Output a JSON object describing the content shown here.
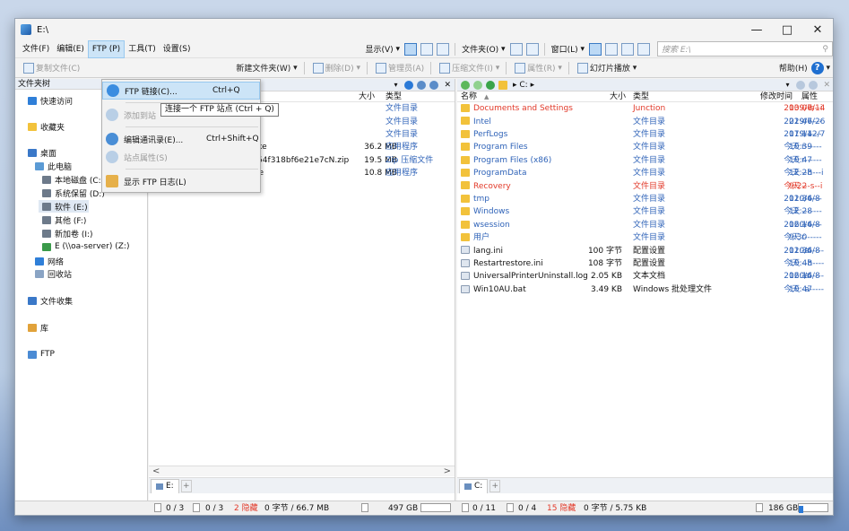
{
  "window": {
    "title": "E:\\"
  },
  "menu": {
    "items": [
      "文件(F)",
      "编辑(E)",
      "FTP (P)",
      "工具(T)",
      "设置(S)"
    ],
    "display_label": "显示(V)",
    "folder_label": "文件夹(O)",
    "window_label": "窗口(L)",
    "search_placeholder": "搜索 E:\\"
  },
  "toolbar": {
    "copy_file": "复制文件(C)",
    "new_folder": "新建文件夹(W)",
    "delete": "删除(D)",
    "admin": "管理员(A)",
    "compress": "压缩文件(I)",
    "properties": "属性(R)",
    "slideshow": "幻灯片播放",
    "help": "帮助(H)"
  },
  "ftp_menu": {
    "items": [
      {
        "label": "FTP 链接(C)...",
        "shortcut": "Ctrl+Q",
        "state": "highlighted"
      },
      {
        "label": "添加到站",
        "shortcut": "",
        "state": "disabled"
      },
      {
        "label": "编辑通讯录(E)...",
        "shortcut": "Ctrl+Shift+Q",
        "state": "normal"
      },
      {
        "label": "站点属性(S)",
        "shortcut": "",
        "state": "disabled"
      },
      {
        "label": "显示 FTP 日志(L)",
        "shortcut": "",
        "state": "normal"
      }
    ],
    "tooltip": "连接一个 FTP 站点 (Ctrl + Q)"
  },
  "tree": {
    "header": "文件夹树",
    "nodes": [
      {
        "label": "快速访问",
        "indent": 0
      },
      {
        "label": "收藏夹",
        "indent": 0
      },
      {
        "label": "桌面",
        "indent": 0
      },
      {
        "label": "此电脑",
        "indent": 1
      },
      {
        "label": "本地磁盘 (C:)",
        "indent": 2
      },
      {
        "label": "系统保留 (D:)",
        "indent": 2
      },
      {
        "label": "软件 (E:)",
        "indent": 2,
        "selected": true
      },
      {
        "label": "其他 (F:)",
        "indent": 2
      },
      {
        "label": "新加卷 (I:)",
        "indent": 2
      },
      {
        "label": "E (\\\\oa-server) (Z:)",
        "indent": 2
      },
      {
        "label": "网络",
        "indent": 1
      },
      {
        "label": "回收站",
        "indent": 1
      },
      {
        "label": "文件收集",
        "indent": 0
      },
      {
        "label": "库",
        "indent": 0
      },
      {
        "label": "FTP",
        "indent": 0
      }
    ]
  },
  "left_pane": {
    "columns": {
      "size": "大小",
      "type": "类型"
    },
    "rows": [
      {
        "name": "",
        "size": "",
        "type": "文件目录"
      },
      {
        "name": "",
        "size": "",
        "type": "文件目录"
      },
      {
        "name": "",
        "size": "",
        "type": "文件目录"
      },
      {
        "name": "DopusInstall-Chinese.exe",
        "size": "36.2 MB",
        "type": "应用程序"
      },
      {
        "name": "H1dea2e913ad24a22854f318bf6e21e7cN.zip",
        "size": "19.5 MB",
        "type": "Zip 压缩文件"
      },
      {
        "name": "TrayStatusSetup-4.6.exe",
        "size": "10.8 MB",
        "type": "应用程序"
      }
    ],
    "tab": "E:",
    "status": {
      "folders": "0 / 3",
      "files": "0 / 3",
      "hidden": "2 隐藏",
      "bytes": "0 字节 / 66.7 MB",
      "free": "497 GB",
      "used_fraction": 0.0
    }
  },
  "right_pane": {
    "path": "C:",
    "columns": {
      "name": "名称",
      "size": "大小",
      "type": "类型",
      "modified": "修改时间",
      "attr": "属性"
    },
    "rows": [
      {
        "name": "Documents and Settings",
        "size": "",
        "type": "Junction",
        "date": "2009/7/14",
        "time": "13:06",
        "attr": "---s--i",
        "red": true,
        "folder": true
      },
      {
        "name": "Intel",
        "size": "",
        "type": "文件目录",
        "date": "2019/7/26",
        "time": "22:46",
        "attr": "-------",
        "folder": true
      },
      {
        "name": "PerfLogs",
        "size": "",
        "type": "文件目录",
        "date": "2019/12/7",
        "time": "17:14",
        "attr": "-------",
        "folder": true
      },
      {
        "name": "Program Files",
        "size": "",
        "type": "文件目录",
        "date": "今天",
        "time": "10:39",
        "attr": "r------",
        "folder": true
      },
      {
        "name": "Program Files (x86)",
        "size": "",
        "type": "文件目录",
        "date": "今天",
        "time": "10:47",
        "attr": "r------",
        "folder": true
      },
      {
        "name": "ProgramData",
        "size": "",
        "type": "文件目录",
        "date": "今天",
        "time": "12:28",
        "attr": "--h---i",
        "folder": true
      },
      {
        "name": "Recovery",
        "size": "",
        "type": "文件目录",
        "date": "今天",
        "time": "9:22",
        "attr": "---s--i",
        "red": true,
        "folder": true
      },
      {
        "name": "tmp",
        "size": "",
        "type": "文件目录",
        "date": "2020/4/8",
        "time": "11:36",
        "attr": "-------",
        "folder": true
      },
      {
        "name": "Windows",
        "size": "",
        "type": "文件目录",
        "date": "今天",
        "time": "12:28",
        "attr": "-------",
        "folder": true
      },
      {
        "name": "wsession",
        "size": "",
        "type": "文件目录",
        "date": "2020/4/8",
        "time": "16:16",
        "attr": "-------",
        "folder": true
      },
      {
        "name": "用户",
        "size": "",
        "type": "文件目录",
        "date": "今天",
        "time": "9:30",
        "attr": "r------",
        "folder": true
      },
      {
        "name": "lang.ini",
        "size": "100 字节",
        "type": "配置设置",
        "date": "2020/4/8",
        "time": "11:36",
        "attr": "-a-----",
        "folder": false
      },
      {
        "name": "Restartrestore.ini",
        "size": "108 字节",
        "type": "配置设置",
        "date": "今天",
        "time": "10:48",
        "attr": "--h----",
        "folder": false
      },
      {
        "name": "UniversalPrinterUninstall.log",
        "size": "2.05 KB",
        "type": "文本文档",
        "date": "2020/4/8",
        "time": "16:16",
        "attr": "-a-----",
        "folder": false
      },
      {
        "name": "Win10AU.bat",
        "size": "3.49 KB",
        "type": "Windows 批处理文件",
        "date": "今天",
        "time": "10:47",
        "attr": "-a-----",
        "folder": false
      }
    ],
    "tab": "C:",
    "status": {
      "folders": "0 / 11",
      "files": "0 / 4",
      "hidden": "15 隐藏",
      "bytes": "0 字节 / 5.75 KB",
      "free": "186 GB",
      "used_fraction": 0.15
    }
  },
  "colors": {
    "accent": "#2a79d7",
    "folder": "#f2c23b",
    "highlight_red": "#e23a2a",
    "type_blue": "#2f63b8"
  }
}
